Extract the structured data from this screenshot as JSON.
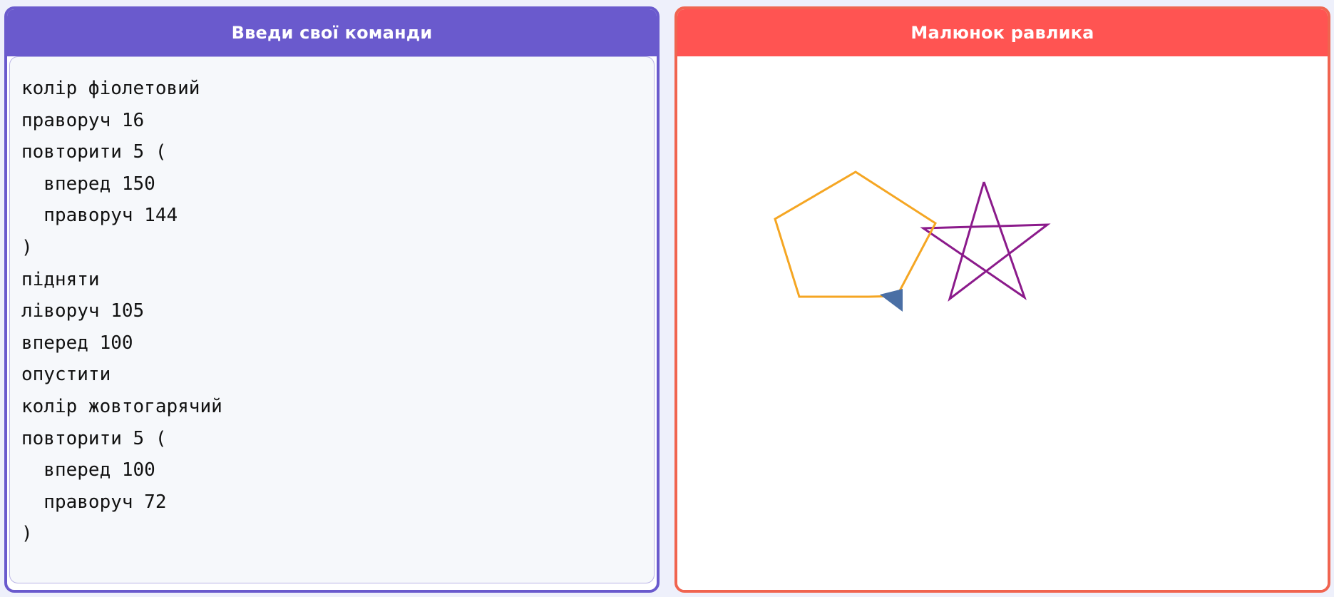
{
  "code_panel": {
    "title": "Введи свої команди",
    "accent_color": "#6a5acd",
    "code": "колір фіолетовий\nправоруч 16\nповторити 5 (\n  вперед 150\n  праворуч 144\n)\nпідняти\nліворуч 105\nвперед 100\nопустити\nколір жовтогарячий\nповторити 5 (\n  вперед 100\n  праворуч 72\n)"
  },
  "drawing_panel": {
    "title": "Малюнок равлика",
    "accent_color": "#ff5452",
    "star_color": "#8b1a8b",
    "pentagon_color": "#f5a623",
    "turtle_color": "#4a6fa5",
    "turtle_icon": "triangle-turtle-icon"
  }
}
